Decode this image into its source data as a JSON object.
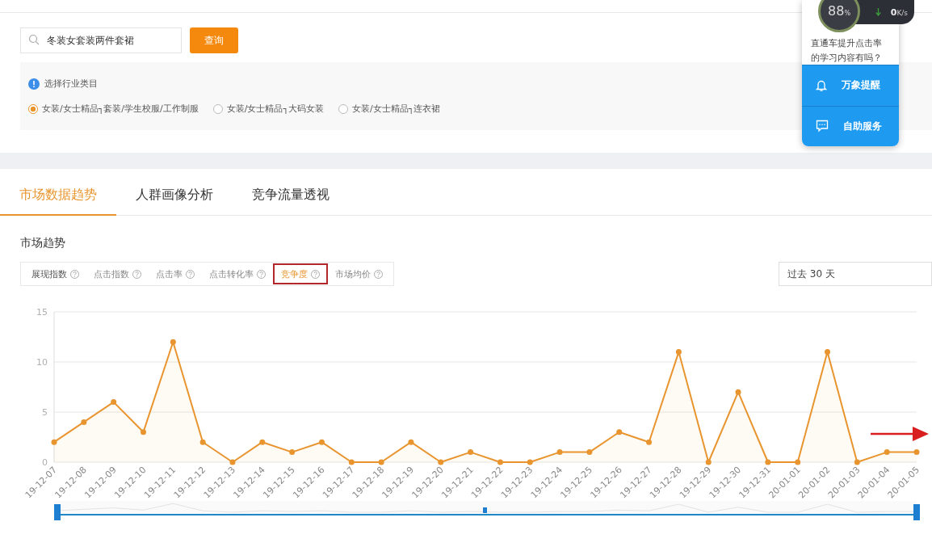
{
  "search": {
    "value": "冬装女套装两件套裙",
    "button": "查询"
  },
  "category": {
    "title": "选择行业类目",
    "options": [
      {
        "label": "女装/女士精品┐套装/学生校服/工作制服",
        "selected": true
      },
      {
        "label": "女装/女士精品┐大码女装",
        "selected": false
      },
      {
        "label": "女装/女士精品┐连衣裙",
        "selected": false
      }
    ]
  },
  "widget": {
    "gauge": "88",
    "unit": "%",
    "speed": "0",
    "speed_unit": "K/s",
    "question": "直通车提升点击率的学习内容有吗？",
    "actions": [
      {
        "label": "万象提醒",
        "kind": "bell"
      },
      {
        "label": "自助服务",
        "kind": "chat"
      }
    ]
  },
  "tabs": [
    {
      "label": "市场数据趋势",
      "selected": true
    },
    {
      "label": "人群画像分析",
      "selected": false
    },
    {
      "label": "竞争流量透视",
      "selected": false
    }
  ],
  "section_title": "市场趋势",
  "metrics": [
    {
      "label": "展现指数",
      "selected": false
    },
    {
      "label": "点击指数",
      "selected": false
    },
    {
      "label": "点击率",
      "selected": false
    },
    {
      "label": "点击转化率",
      "selected": false
    },
    {
      "label": "竞争度",
      "selected": true
    },
    {
      "label": "市场均价",
      "selected": false
    }
  ],
  "period": "过去 30 天",
  "chart_data": {
    "type": "area",
    "categories": [
      "19-12-07",
      "19-12-08",
      "19-12-09",
      "19-12-10",
      "19-12-11",
      "19-12-12",
      "19-12-13",
      "19-12-14",
      "19-12-15",
      "19-12-16",
      "19-12-17",
      "19-12-18",
      "19-12-19",
      "19-12-20",
      "19-12-21",
      "19-12-22",
      "19-12-23",
      "19-12-24",
      "19-12-25",
      "19-12-26",
      "19-12-27",
      "19-12-28",
      "19-12-29",
      "19-12-30",
      "19-12-31",
      "20-01-01",
      "20-01-02",
      "20-01-03",
      "20-01-04",
      "20-01-05"
    ],
    "series": [
      {
        "color": "#e8952f",
        "values": [
          2,
          4,
          6,
          3,
          12,
          2,
          0,
          2,
          1,
          2,
          0,
          0,
          2,
          0,
          1,
          0,
          0,
          1,
          1,
          3,
          2,
          11,
          0,
          7,
          0,
          0,
          11,
          0,
          1,
          1
        ]
      }
    ],
    "ylim": [
      0,
      15
    ],
    "yticks": [
      0,
      5,
      10,
      15
    ]
  }
}
